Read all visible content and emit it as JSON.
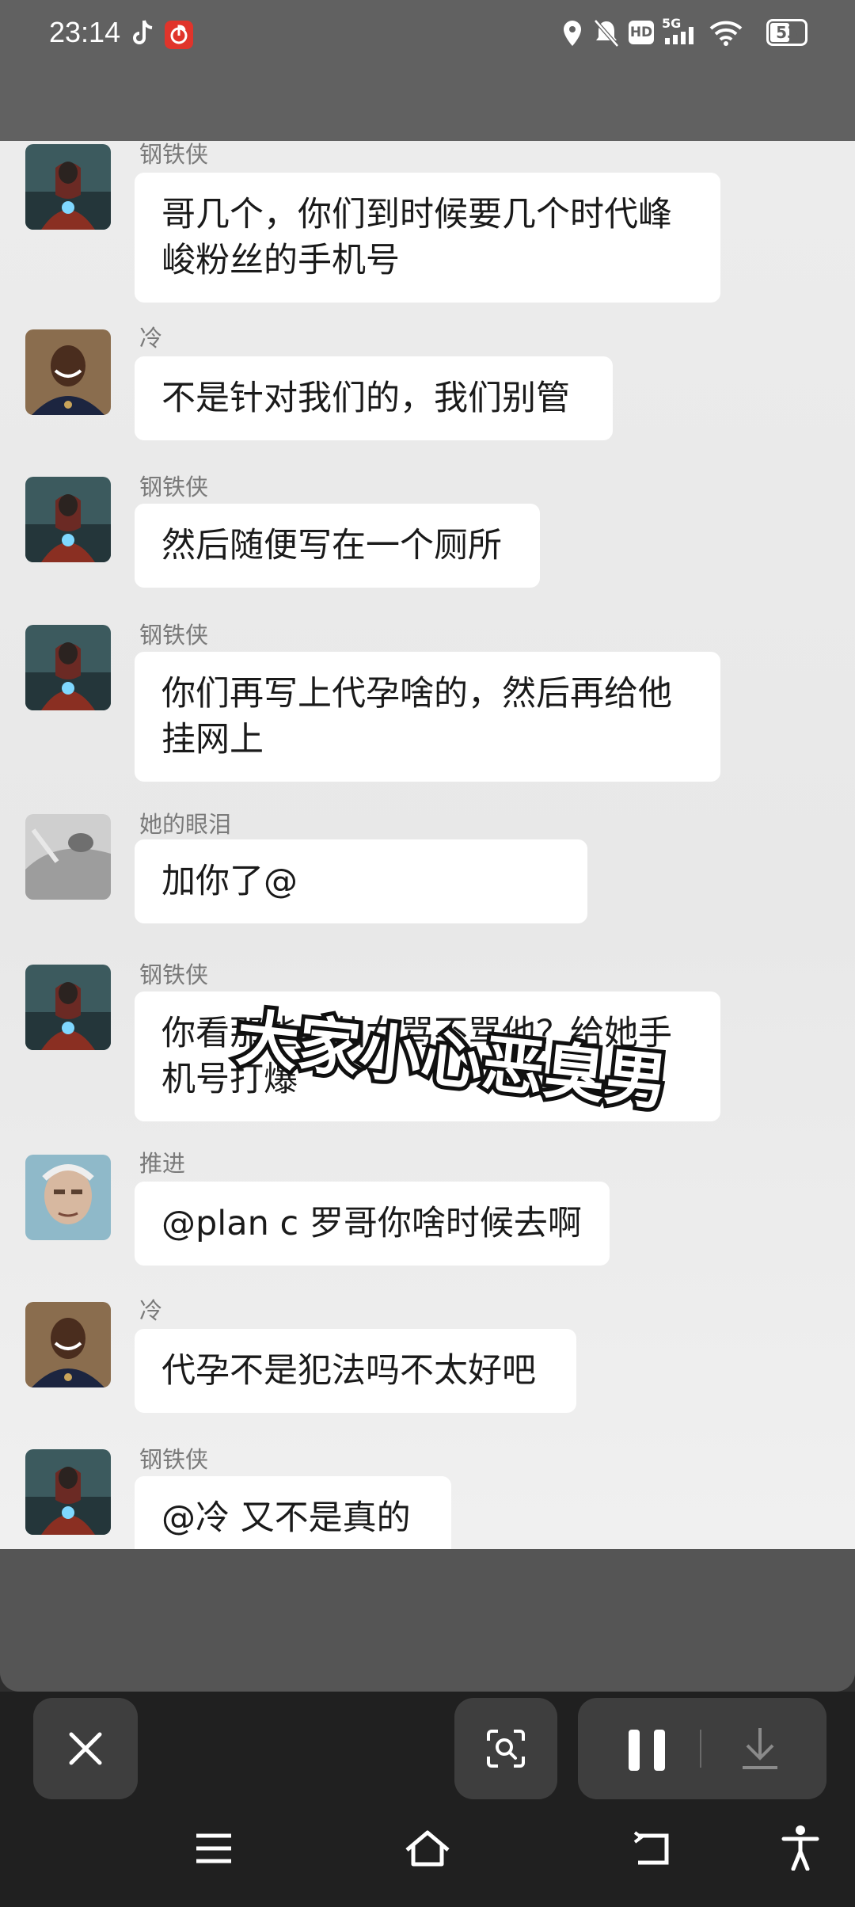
{
  "status_bar": {
    "time": "23:14",
    "network": "5G",
    "hd_badge": "HD",
    "battery": "53",
    "icons": [
      "tiktok-icon",
      "netease-music-icon",
      "location-icon",
      "mute-bell-icon",
      "hd-icon",
      "signal-icon",
      "wifi-icon",
      "battery-icon"
    ]
  },
  "chat": {
    "messages": [
      {
        "sender": "钢铁侠",
        "lines": [
          "哥几个，你们到时候要几个时代峰",
          "峻粉丝的手机号"
        ],
        "avatar": "ironman-avatar"
      },
      {
        "sender": "冷",
        "lines": [
          "不是针对我们的，我们别管"
        ],
        "avatar": "football-player-avatar"
      },
      {
        "sender": "钢铁侠",
        "lines": [
          "然后随便写在一个厕所"
        ],
        "avatar": "ironman-avatar"
      },
      {
        "sender": "钢铁侠",
        "lines": [
          "你们再写上代孕啥的，然后再给他",
          "挂网上"
        ],
        "avatar": "ironman-avatar"
      },
      {
        "sender": "她的眼泪",
        "lines": [
          "加你了@"
        ],
        "avatar": "grey-photo-avatar"
      },
      {
        "sender": "钢铁侠",
        "lines": [
          "你看那些小仙女骂不骂他？给她手",
          "机号打爆"
        ],
        "avatar": "ironman-avatar"
      },
      {
        "sender": "推进",
        "lines": [
          "@plan c  罗哥你啥时候去啊"
        ],
        "avatar": "older-man-avatar"
      },
      {
        "sender": "冷",
        "lines": [
          "代孕不是犯法吗不太好吧"
        ],
        "avatar": "football-player-avatar"
      },
      {
        "sender": "钢铁侠",
        "lines": [
          "@冷  又不是真的"
        ],
        "avatar": "ironman-avatar"
      }
    ]
  },
  "overlay": {
    "text": "大家小心恶臭男"
  },
  "toolbar": {
    "close_icon": "close-icon",
    "lens_icon": "screenshot-search-icon",
    "pause_icon": "pause-icon",
    "download_icon": "download-icon"
  },
  "nav": {
    "icons": [
      "menu-icon",
      "home-icon",
      "back-icon",
      "accessibility-icon"
    ]
  },
  "colors": {
    "status_bg": "#616161",
    "chat_bg": "#ececec",
    "bubble_bg": "#ffffff",
    "toolbar_bg": "#202020",
    "button_bg": "#3e3e3e"
  }
}
